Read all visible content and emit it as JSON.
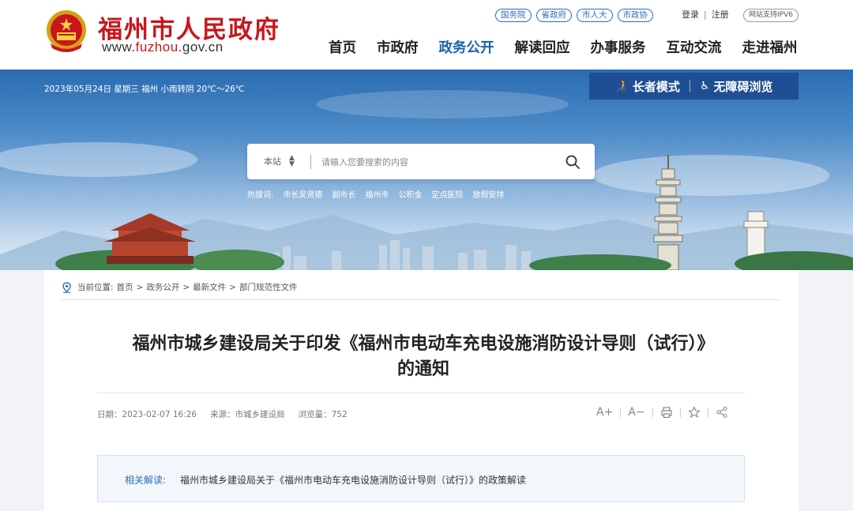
{
  "header": {
    "site_name": "福州市人民政府",
    "url_prefix": "www.",
    "url_brand": "fuzhou",
    "url_suffix": ".gov.cn",
    "top_links": [
      "国务院",
      "省政府",
      "市人大",
      "市政协"
    ],
    "login": "登录",
    "register": "注册",
    "login_sep": "|",
    "ipv6": "网站支持IPV6",
    "nav": [
      "首页",
      "市政府",
      "政务公开",
      "解读回应",
      "办事服务",
      "互动交流",
      "走进福州"
    ],
    "active_nav": "政务公开"
  },
  "banner": {
    "date_weather": "2023年05月24日 星期三 福州 小雨转阴 20℃～26℃",
    "elder_mode": "长者模式",
    "accessible": "无障碍浏览",
    "search": {
      "scope": "本站",
      "placeholder": "请输入您要搜索的内容"
    },
    "hot_label": "热搜词:",
    "hot_words": [
      "市长吴贤德",
      "副市长",
      "福州市",
      "公积金",
      "定点医院",
      "放假安排"
    ]
  },
  "article": {
    "breadcrumb_label": "当前位置:",
    "breadcrumb": [
      "首页",
      "政务公开",
      "最新文件",
      "部门规范性文件"
    ],
    "breadcrumb_sep": ">",
    "title_line1": "福州市城乡建设局关于印发《福州市电动车充电设施消防设计导则（试行）》",
    "title_line2": "的通知",
    "date": "日期：2023-02-07 16:26",
    "source": "来源：市城乡建设局",
    "views": "浏览量：752",
    "font_increase": "A+",
    "font_decrease": "A−",
    "related_label": "相关解读:",
    "related_text": "福州市城乡建设局关于《福州市电动车充电设施消防设计导则（试行）》的政策解读"
  },
  "colors": {
    "brand_red": "#c8161d",
    "nav_active": "#1b5fb0",
    "accent_blue": "#2d6bbd",
    "mode_box": "#1f4f92"
  }
}
